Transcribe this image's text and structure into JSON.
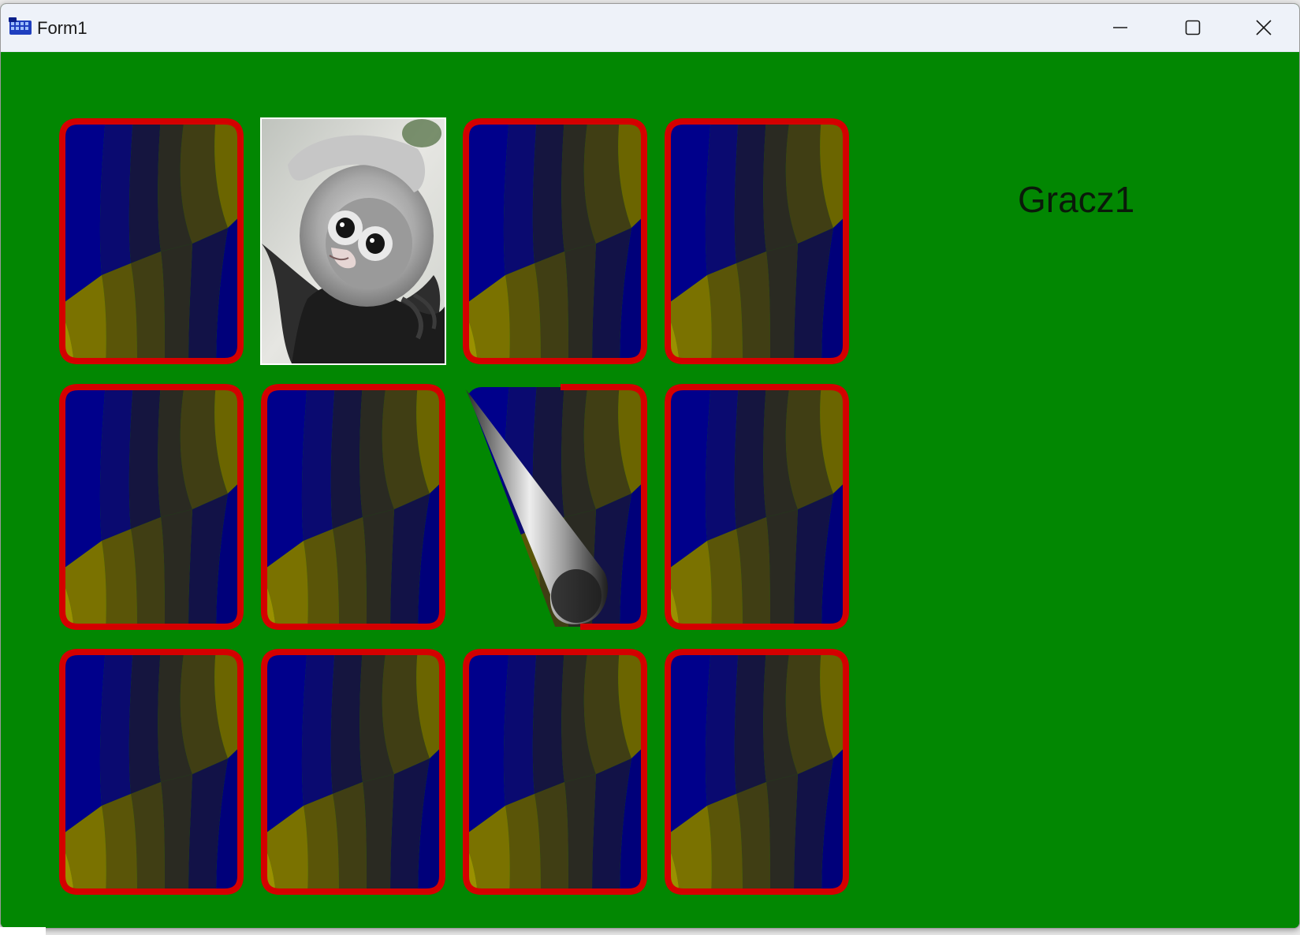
{
  "window": {
    "title": "Form1",
    "controls": {
      "minimize": "minimize-icon",
      "maximize": "maximize-icon",
      "close": "close-icon"
    }
  },
  "game": {
    "player_label": "Gracz1",
    "background_color": "#028702",
    "card_back_colors": {
      "border": "#d40000",
      "blue": "#00008b",
      "olive": "#7a7200"
    },
    "grid": {
      "rows": 3,
      "columns": 4
    },
    "cards": [
      {
        "state": "face-down"
      },
      {
        "state": "face-up",
        "image": "monkey-photo"
      },
      {
        "state": "face-down"
      },
      {
        "state": "face-down"
      },
      {
        "state": "face-down"
      },
      {
        "state": "face-down"
      },
      {
        "state": "flipping"
      },
      {
        "state": "face-down"
      },
      {
        "state": "face-down"
      },
      {
        "state": "face-down"
      },
      {
        "state": "face-down"
      },
      {
        "state": "face-down"
      }
    ]
  }
}
